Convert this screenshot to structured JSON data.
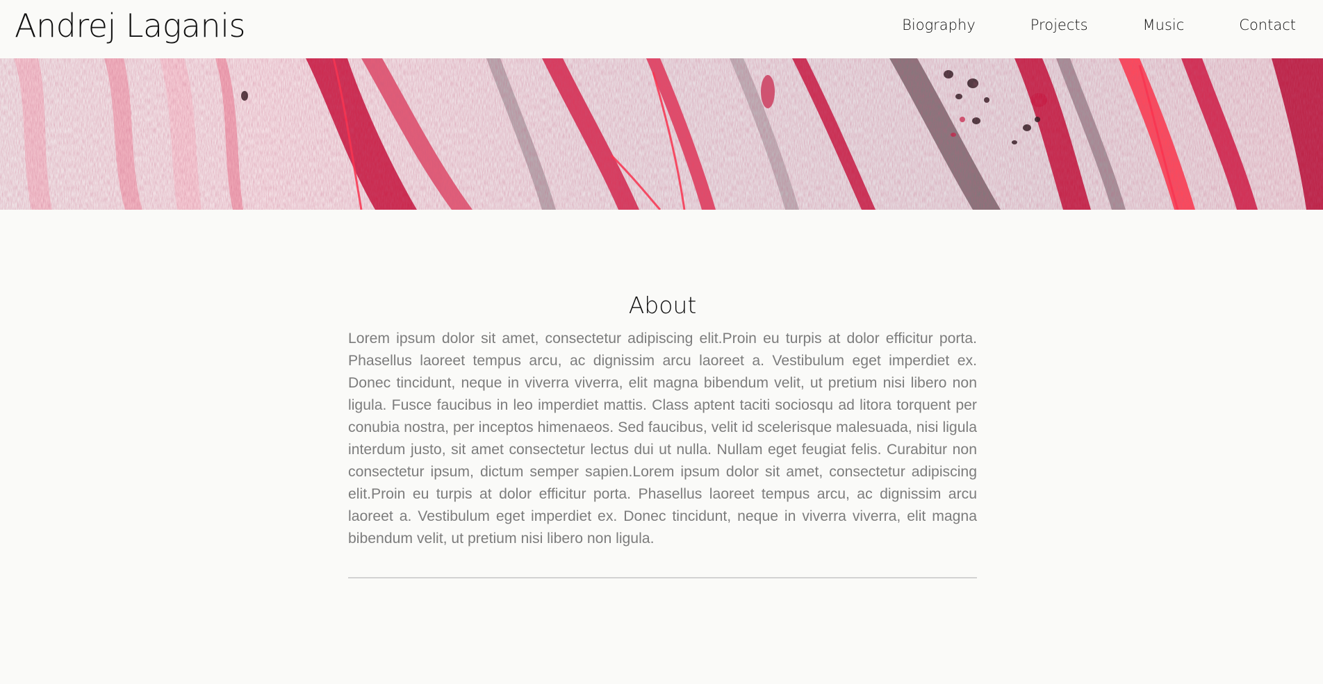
{
  "header": {
    "site_title": "Andrej Laganis",
    "nav": [
      {
        "label": "Biography"
      },
      {
        "label": "Projects"
      },
      {
        "label": "Music"
      },
      {
        "label": "Contact"
      }
    ]
  },
  "hero": {
    "image": "marbled-paint-banner",
    "colors": {
      "base": "#ece6e9",
      "crimson": "#c8173f",
      "pink": "#f0a6b6",
      "dark": "#2a1a1f"
    }
  },
  "about": {
    "title": "About",
    "body": "Lorem ipsum dolor sit amet, consectetur adipiscing elit.Proin eu turpis at dolor efficitur porta. Phasellus laoreet tempus arcu, ac dignissim arcu laoreet a. Vestibulum eget imperdiet ex. Donec tincidunt, neque in viverra viverra, elit magna bibendum velit, ut pretium nisi libero non ligula. Fusce faucibus in leo imperdiet mattis. Class aptent taciti sociosqu ad litora torquent per conubia nostra, per inceptos himenaeos. Sed faucibus, velit id scelerisque malesuada, nisi ligula interdum justo, sit amet consectetur lectus dui ut nulla. Nullam eget feugiat felis. Curabitur non consectetur ipsum, dictum semper sapien.Lorem ipsum dolor sit amet, consectetur adipiscing elit.Proin eu turpis at dolor efficitur porta. Phasellus laoreet tempus arcu, ac dignissim arcu laoreet a. Vestibulum eget imperdiet ex. Donec tincidunt, neque in viverra viverra, elit magna bibendum velit, ut pretium nisi libero non ligula."
  }
}
